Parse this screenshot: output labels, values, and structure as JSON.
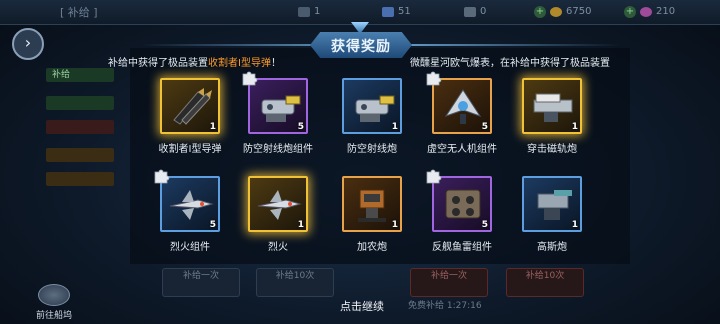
{
  "topbar": {
    "title": "[ 补给 ]",
    "resources": [
      {
        "icon": "fuel-icon",
        "value": "1"
      },
      {
        "icon": "crystal-icon",
        "value": "51"
      },
      {
        "icon": "metal-icon",
        "value": "0"
      },
      {
        "icon": "gold-coin-icon",
        "value": "6750"
      },
      {
        "icon": "gem-icon",
        "value": "210"
      }
    ]
  },
  "modal": {
    "title": "获得奖励",
    "marquee_left_prefix": "补给中获得了极品装置",
    "marquee_left_highlight": "收割者I型导弹",
    "marquee_left_suffix": "！",
    "marquee_right": "微醺星河欧气爆表，在补给中获得了极品装置",
    "continue_label": "点击继续"
  },
  "items": [
    {
      "name": "收割者I型导弹",
      "count": "1",
      "rarity": "gold",
      "fragment": false,
      "art": "missile"
    },
    {
      "name": "防空射线炮组件",
      "count": "5",
      "rarity": "purple",
      "fragment": true,
      "art": "laser"
    },
    {
      "name": "防空射线炮",
      "count": "1",
      "rarity": "blue",
      "fragment": false,
      "art": "laser"
    },
    {
      "name": "虚空无人机组件",
      "count": "5",
      "rarity": "orange",
      "fragment": true,
      "art": "drone"
    },
    {
      "name": "穿击磁轨炮",
      "count": "1",
      "rarity": "gold",
      "fragment": false,
      "art": "railgun"
    },
    {
      "name": "烈火组件",
      "count": "5",
      "rarity": "blue",
      "fragment": true,
      "art": "fighter"
    },
    {
      "name": "烈火",
      "count": "1",
      "rarity": "gold",
      "fragment": false,
      "art": "fighter"
    },
    {
      "name": "加农炮",
      "count": "1",
      "rarity": "orange",
      "fragment": false,
      "art": "cannon"
    },
    {
      "name": "反舰鱼雷组件",
      "count": "5",
      "rarity": "purple",
      "fragment": true,
      "art": "torpedo"
    },
    {
      "name": "高斯炮",
      "count": "1",
      "rarity": "blue",
      "fragment": false,
      "art": "gauss"
    }
  ],
  "background": {
    "side_tabs": [
      "补给",
      "",
      "",
      "",
      ""
    ],
    "bottom_buttons": [
      "补给一次",
      "补给10次",
      "补给一次",
      "补给10次"
    ],
    "free_text": "免费补给 1:27:16",
    "ship_nav_label": "前往船坞"
  }
}
